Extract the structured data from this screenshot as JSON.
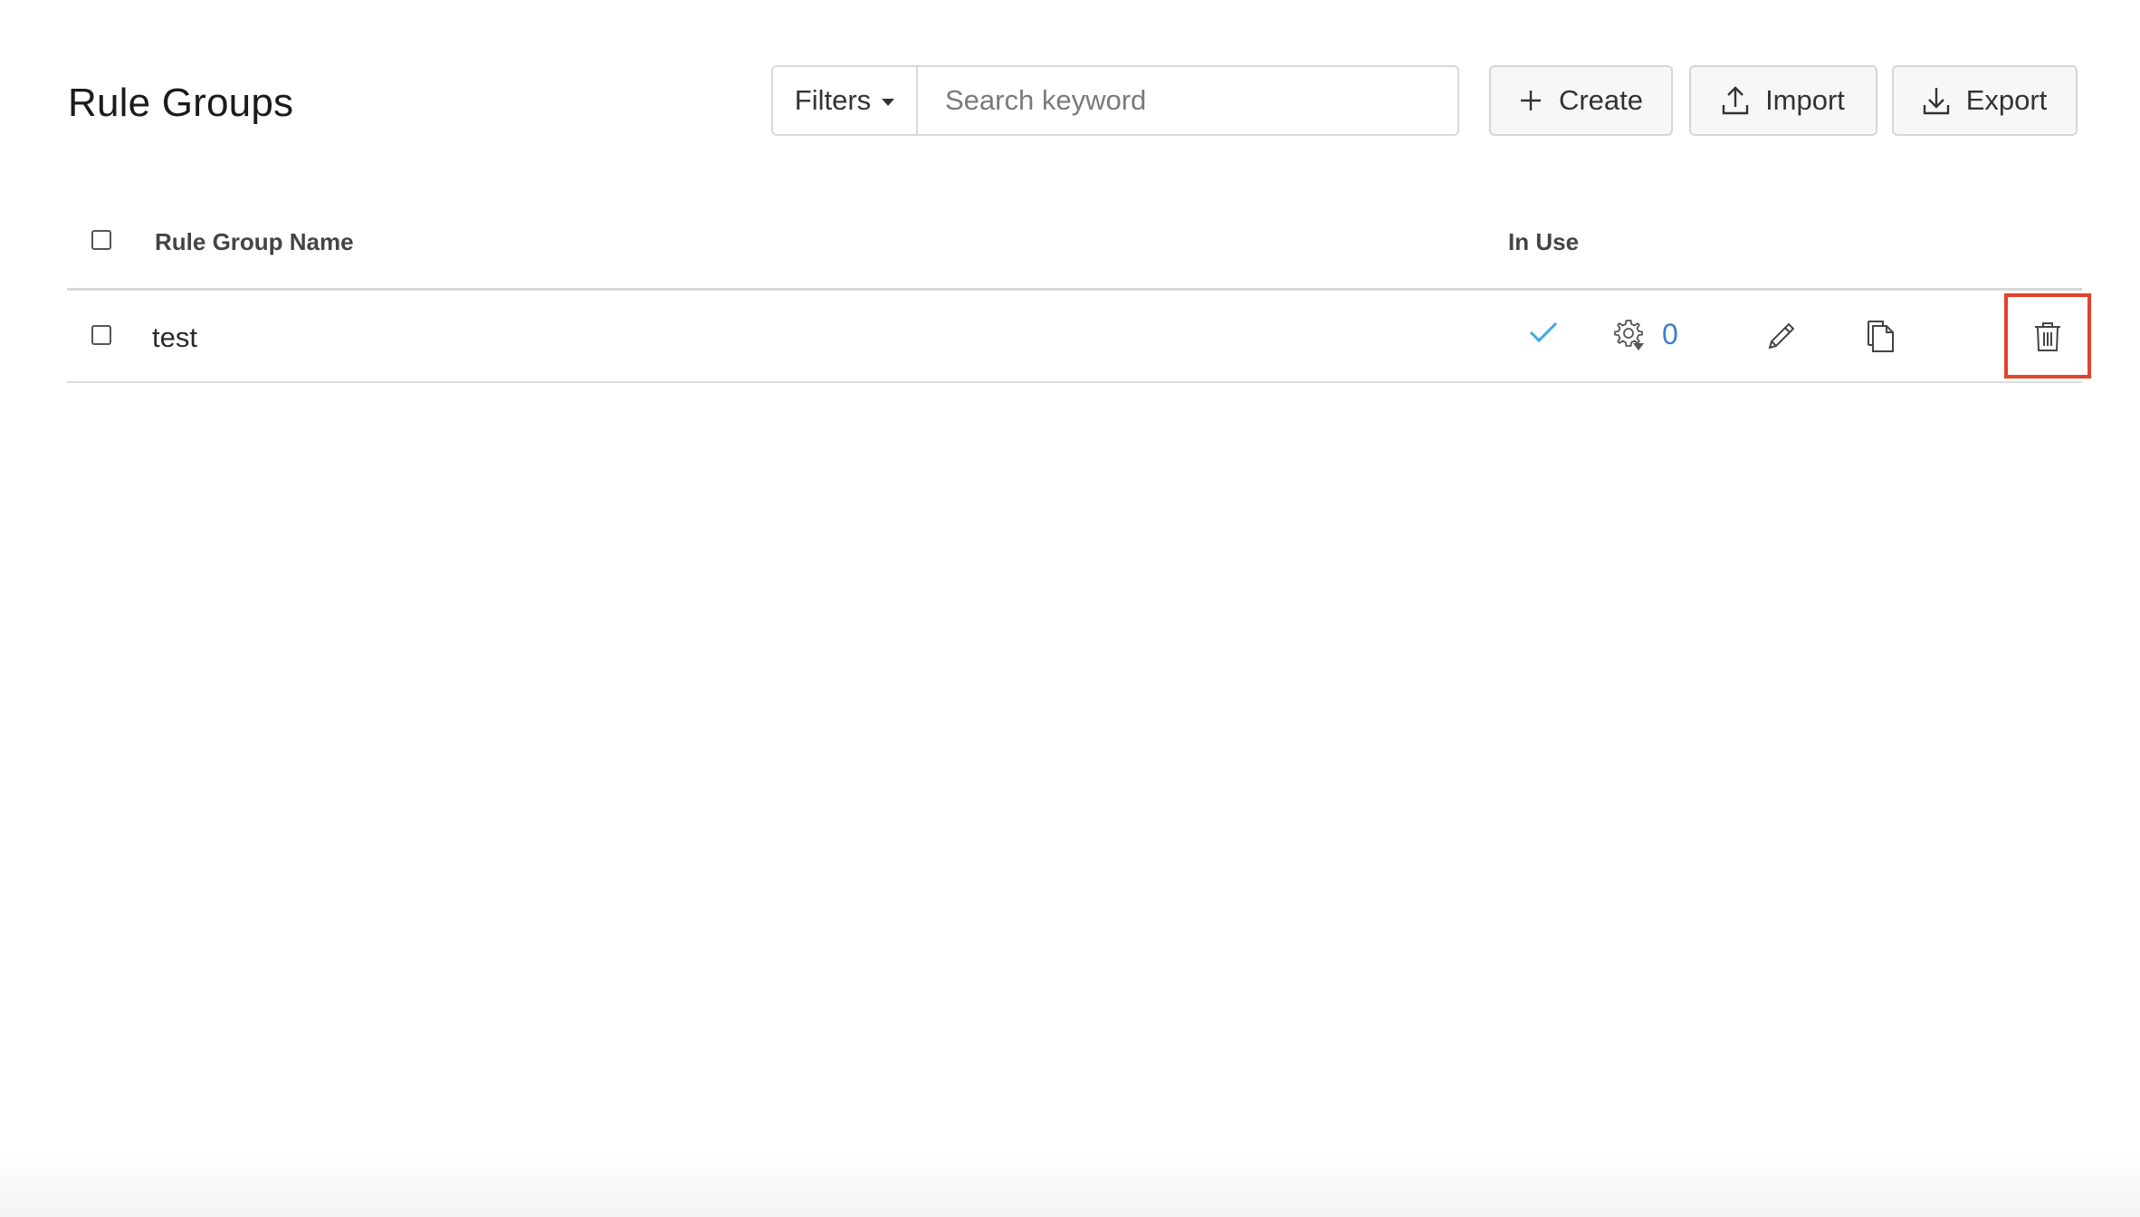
{
  "page": {
    "title": "Rule Groups"
  },
  "toolbar": {
    "filters_label": "Filters",
    "search_placeholder": "Search keyword",
    "search_value": "",
    "create_label": "Create",
    "import_label": "Import",
    "export_label": "Export"
  },
  "table": {
    "columns": {
      "name": "Rule Group Name",
      "in_use": "In Use"
    },
    "rows": [
      {
        "name": "test",
        "in_use": true,
        "rules_count": "0"
      }
    ]
  },
  "colors": {
    "accent_blue": "#3a7fc8",
    "check_blue": "#3fa4e8",
    "highlight_red": "#e0432e"
  },
  "icons": {
    "create": "plus-icon",
    "import": "upload-icon",
    "export": "download-icon",
    "in_use": "checkmark-icon",
    "rules": "gear-icon",
    "edit": "pencil-icon",
    "copy": "copy-icon",
    "delete": "trash-icon"
  }
}
